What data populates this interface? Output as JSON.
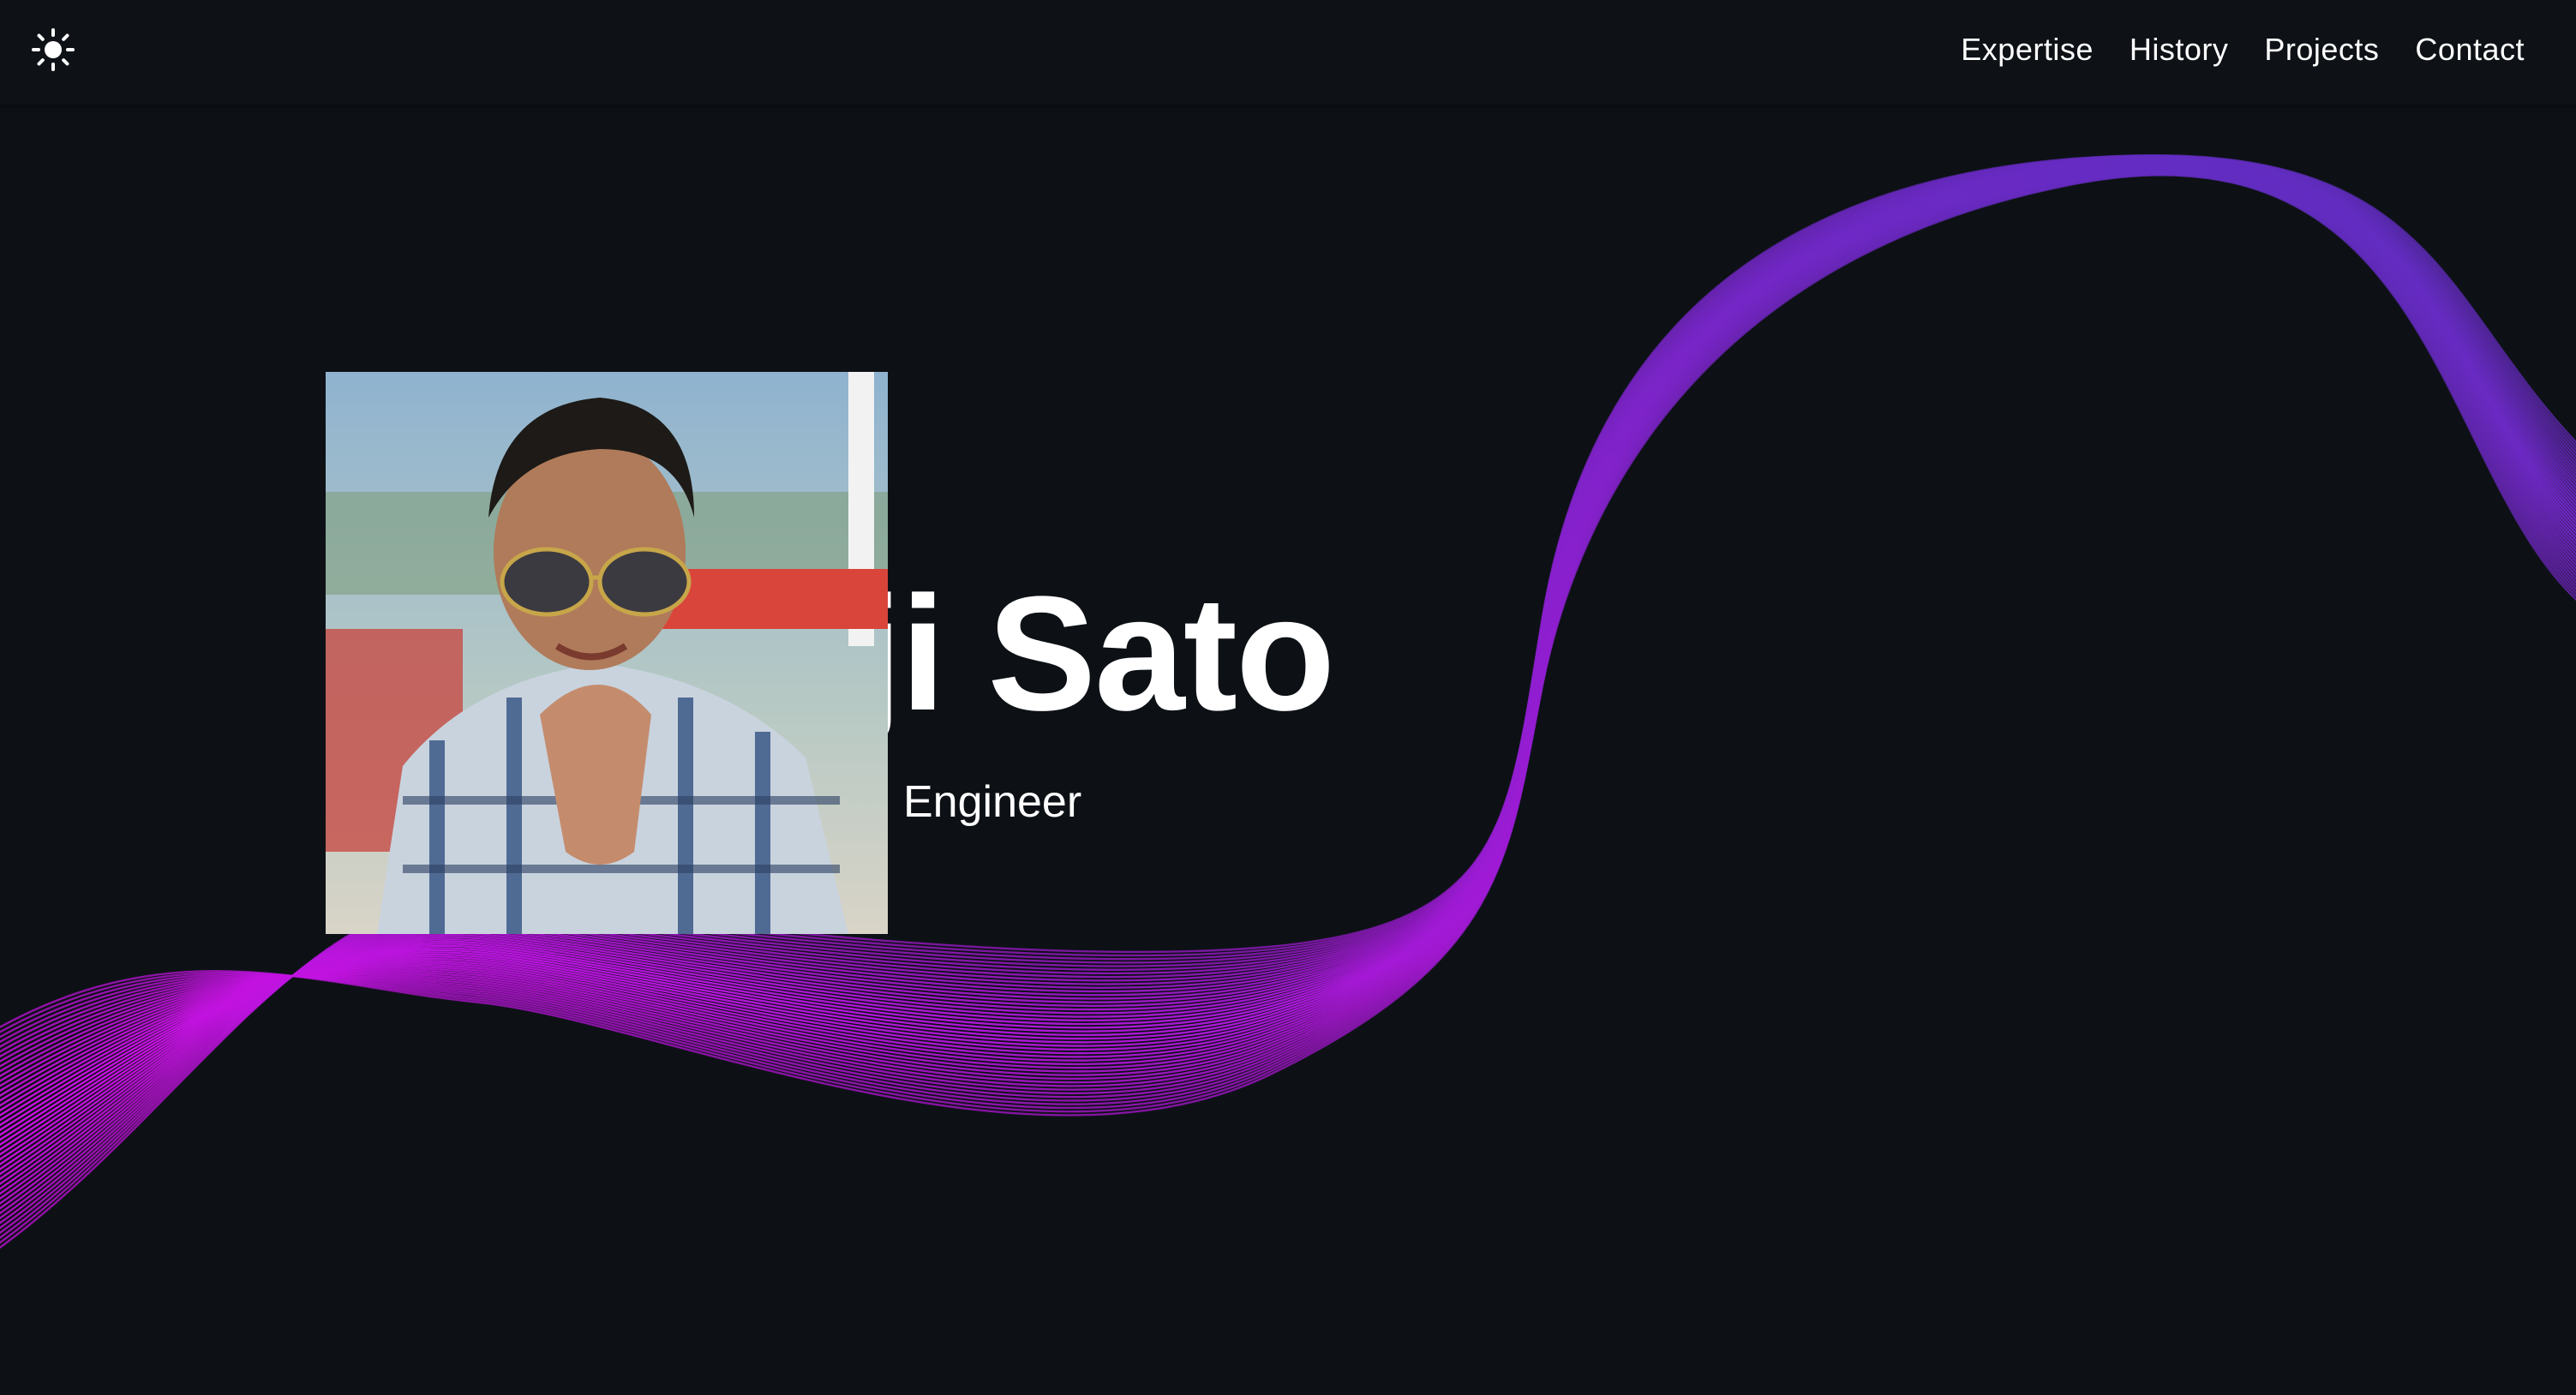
{
  "header": {
    "theme_toggle_icon": "sun-icon",
    "nav": [
      {
        "label": "Expertise"
      },
      {
        "label": "History"
      },
      {
        "label": "Projects"
      },
      {
        "label": "Contact"
      }
    ]
  },
  "hero": {
    "name": "ji Sato",
    "role": "Engineer",
    "photo_icon": "profile-photo"
  },
  "colors": {
    "background": "#0d1116",
    "wave_start": "#d10fe6",
    "wave_mid": "#8e1ecf",
    "wave_end": "#5a2fbf",
    "text": "#ffffff"
  }
}
